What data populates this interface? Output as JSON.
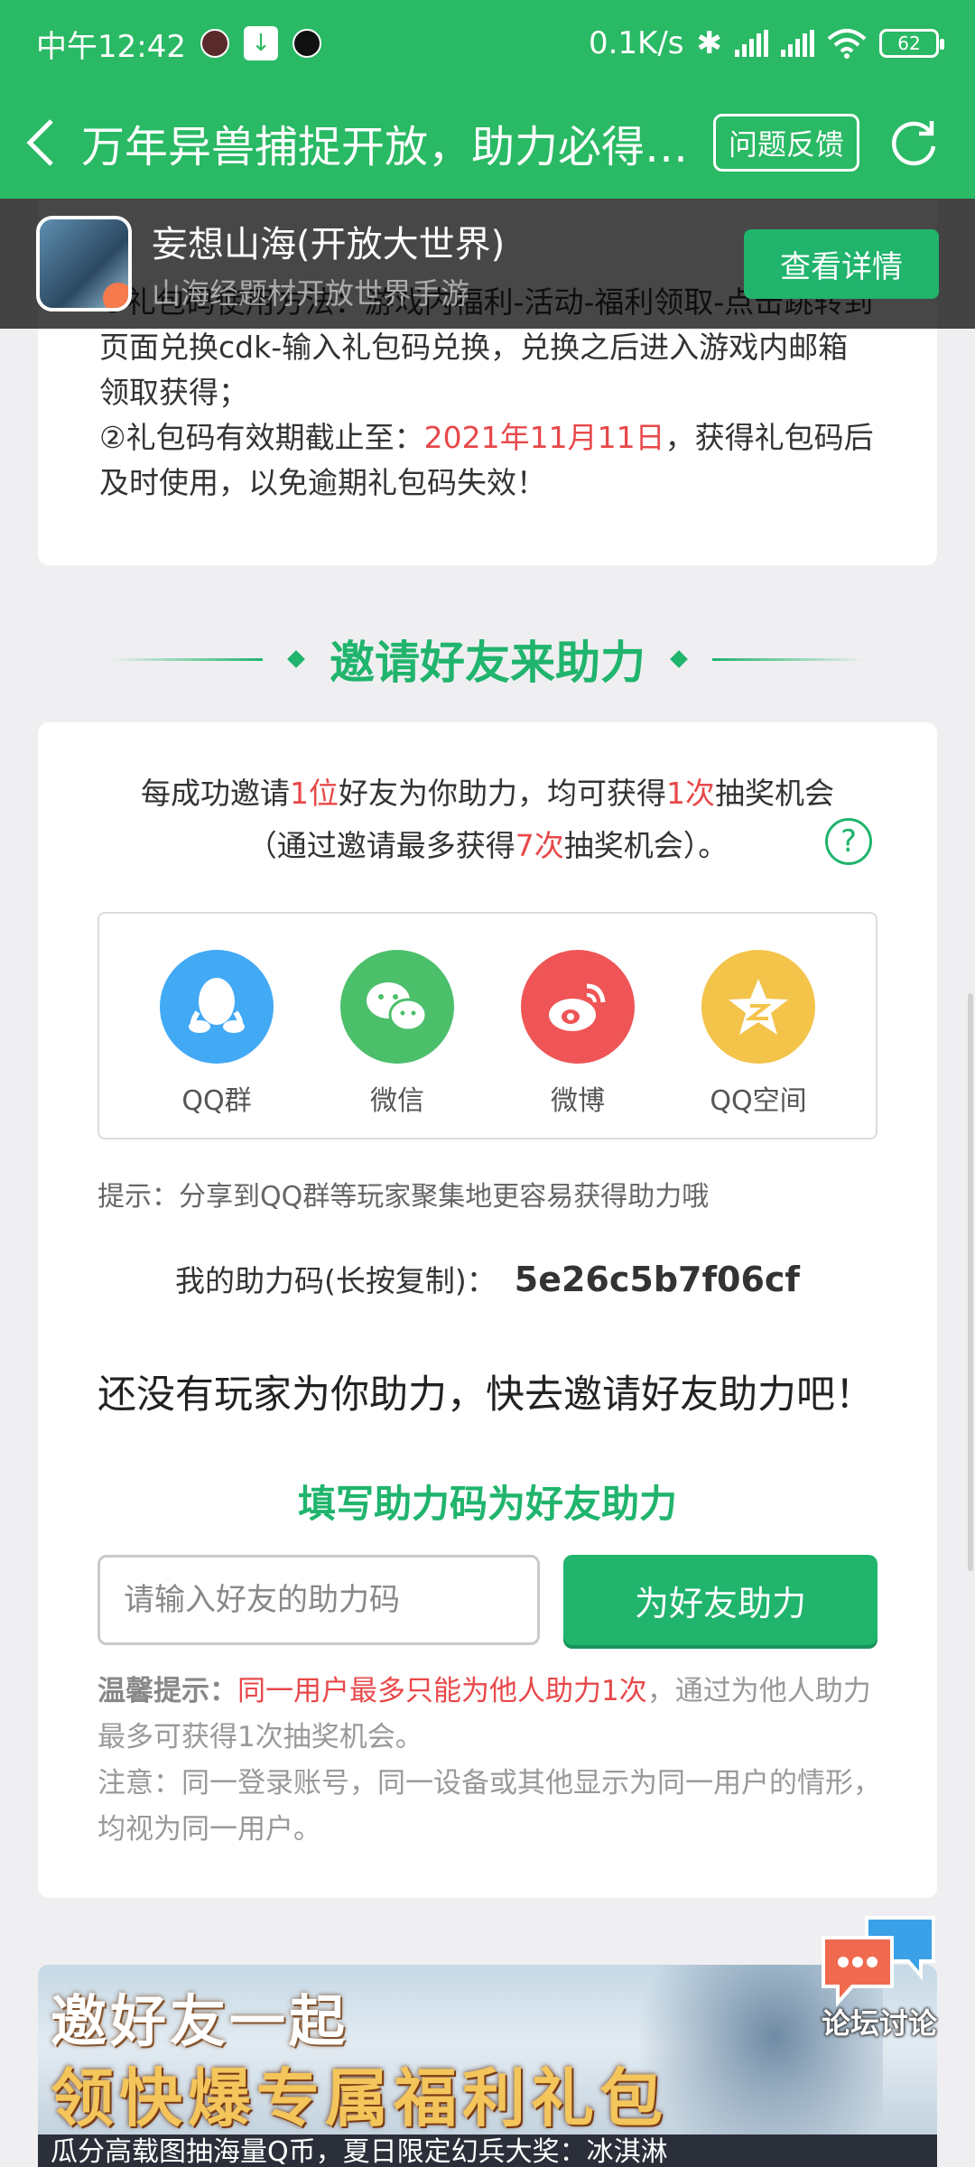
{
  "status_bar": {
    "time": "中午12:42",
    "net_speed": "0.1K/s",
    "battery": "62"
  },
  "header": {
    "title": "万年异兽捕捉开放，助力必得…",
    "feedback_label": "问题反馈",
    "back_icon": "chevron-left-icon",
    "refresh_icon": "refresh-icon"
  },
  "game": {
    "name": "妄想山海(开放大世界)",
    "subtitle": "山海经题材开放世界手游",
    "detail_label": "查看详情"
  },
  "rules": {
    "line1": "①礼包码使用方法：游戏内福利-活动-福利领取-点击跳转到页面兑换cdk-输入礼包码兑换，兑换之后进入游戏内邮箱领取获得；",
    "line2_prefix": "②礼包码有效期截止至：",
    "line2_date": "2021年11月11日",
    "line2_suffix": "，获得礼包码后及时使用，以免逾期礼包码失效！"
  },
  "invite": {
    "section_title": "邀请好友来助力",
    "desc_a": "每成功邀请",
    "desc_b": "1位",
    "desc_c": "好友为你助力，均可获得",
    "desc_d": "1次",
    "desc_e": "抽奖机会",
    "desc_f": "（通过邀请最多获得",
    "desc_g": "7次",
    "desc_h": "抽奖机会）。",
    "help_icon": "?",
    "share": [
      {
        "label": "QQ群",
        "icon": "qq-icon",
        "color": "#42a9f5"
      },
      {
        "label": "微信",
        "icon": "wechat-icon",
        "color": "#4cbf6b"
      },
      {
        "label": "微博",
        "icon": "weibo-icon",
        "color": "#ef5556"
      },
      {
        "label": "QQ空间",
        "icon": "qzone-icon",
        "color": "#f3c34a"
      }
    ],
    "tip": "提示：分享到QQ群等玩家聚集地更容易获得助力哦",
    "code_label": "我的助力码(长按复制)：",
    "code_value": "5e26c5b7f06cf",
    "no_help_text": "还没有玩家为你助力，快去邀请好友助力吧！"
  },
  "fill": {
    "title": "填写助力码为好友助力",
    "input_placeholder": "请输入好友的助力码",
    "button_label": "为好友助力",
    "warm_label": "温馨提示：",
    "warm_red": "同一用户最多只能为他人助力1次",
    "warm_rest": "，通过为他人助力最多可获得1次抽奖机会。",
    "note": "注意：同一登录账号，同一设备或其他显示为同一用户的情形，均视为同一用户。"
  },
  "banner": {
    "line1": "邀好友一起",
    "line2": "领快爆专属福利礼包",
    "line3": "瓜分高载图抽海量Q币，夏日限定幻兵大奖：冰淇淋"
  },
  "forum": {
    "label": "论坛讨论"
  },
  "colors": {
    "brand_green": "#2ab964",
    "button_green": "#20b46d",
    "highlight_red": "#e8484a"
  }
}
